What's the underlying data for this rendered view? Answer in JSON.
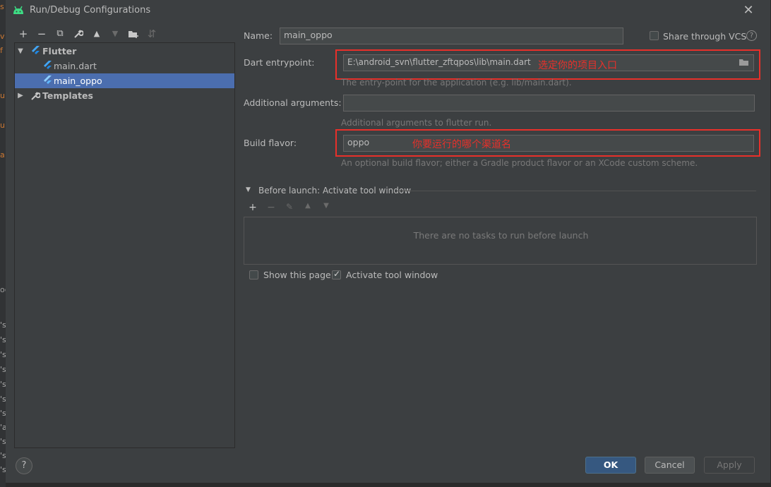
{
  "window": {
    "title": "Run/Debug Configurations",
    "close_glyph": "✕"
  },
  "background": {
    "glyphs": [
      "s",
      "v",
      "f",
      "u",
      "u",
      "a",
      "oc",
      "'s",
      "'s",
      "'s",
      "'s",
      "'s",
      "'s",
      "'s",
      "'a",
      "'s",
      "'s",
      "'s",
      "'v",
      "'s"
    ]
  },
  "toolbar": {
    "add": "+",
    "remove": "−",
    "copy": "⧉",
    "edit": "🔧",
    "up": "▲",
    "down": "▼",
    "new_folder": "📁",
    "sort": "⇵"
  },
  "tree": {
    "items": [
      {
        "label": "Flutter",
        "arrow": "▼"
      },
      {
        "label": "main.dart"
      },
      {
        "label": "main_oppo"
      },
      {
        "label": "Templates",
        "arrow": "▶"
      }
    ]
  },
  "form": {
    "name_label": "Name:",
    "name_value": "main_oppo",
    "share_label": "Share through VCS",
    "help_glyph": "?",
    "entrypoint_label": "Dart entrypoint:",
    "entrypoint_value": "E:\\android_svn\\flutter_zftqpos\\lib\\main.dart",
    "entrypoint_hint": "The entry-point for the application (e.g. lib/main.dart).",
    "entrypoint_annotation": "选定你的项目入口",
    "args_label": "Additional arguments:",
    "args_value": "",
    "args_hint": "Additional arguments to flutter run.",
    "flavor_label": "Build flavor:",
    "flavor_value": "oppo",
    "flavor_hint": "An optional build flavor; either a Gradle product flavor or an XCode custom scheme.",
    "flavor_annotation": "你要运行的哪个渠道名"
  },
  "before_launch": {
    "label": "Before launch: Activate tool window",
    "empty_text": "There are no tasks to run before launch",
    "show_page_label": "Show this page",
    "show_page_checked": false,
    "activate_label": "Activate tool window",
    "activate_checked": true
  },
  "buttons": {
    "ok": "OK",
    "cancel": "Cancel",
    "apply": "Apply"
  },
  "colors": {
    "accent": "#4b6eaf",
    "annotation": "#e8302a",
    "dialog_bg": "#3c3f41"
  }
}
